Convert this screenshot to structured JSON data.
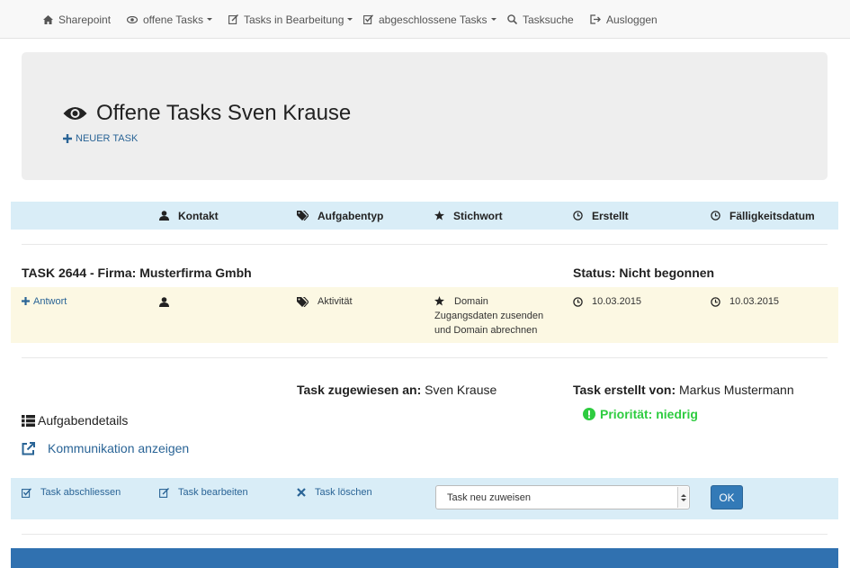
{
  "nav": {
    "items": [
      {
        "label": "Sharepoint",
        "icon": "home-icon",
        "dropdown": false
      },
      {
        "label": "offene Tasks",
        "icon": "eye-icon",
        "dropdown": true
      },
      {
        "label": "Tasks in Bearbeitung",
        "icon": "edit-icon",
        "dropdown": true
      },
      {
        "label": "abgeschlossene Tasks",
        "icon": "check-square-icon",
        "dropdown": true
      },
      {
        "label": "Tasksuche",
        "icon": "search-icon",
        "dropdown": false
      },
      {
        "label": "Ausloggen",
        "icon": "logout-icon",
        "dropdown": false
      }
    ]
  },
  "header": {
    "title": "Offene Tasks Sven Krause",
    "new_task_label": "NEUER TASK"
  },
  "table": {
    "columns": [
      "Kontakt",
      "Aufgabentyp",
      "Stichwort",
      "Erstellt",
      "Fälligkeitsdatum"
    ]
  },
  "task": {
    "title": "TASK 2644 - Firma: Musterfirma Gmbh",
    "status": "Status: Nicht begonnen",
    "answer_label": "Antwort",
    "type": "Aktivität",
    "keyword_lines": [
      "Domain",
      "Zugangsdaten zusenden",
      "und Domain abrechnen"
    ],
    "created": "10.03.2015",
    "due": "10.03.2015",
    "assigned_label": "Task zugewiesen an:",
    "assigned_to": "Sven Krause",
    "created_by_label": "Task erstellt von:",
    "created_by": "Markus Mustermann",
    "priority": "Priorität: niedrig",
    "details_label": "Aufgabendetails",
    "communication_label": "Kommunikation anzeigen"
  },
  "actions": {
    "close_label": "Task abschliessen",
    "edit_label": "Task bearbeiten",
    "delete_label": "Task löschen",
    "reassign_selected": "Task neu zuweisen",
    "ok_label": "OK"
  },
  "colors": {
    "link": "#2a6496",
    "header_bg": "#d9edf7",
    "row_bg": "#fcf8e3",
    "priority": "#2ecc40",
    "primary": "#337ab7"
  }
}
